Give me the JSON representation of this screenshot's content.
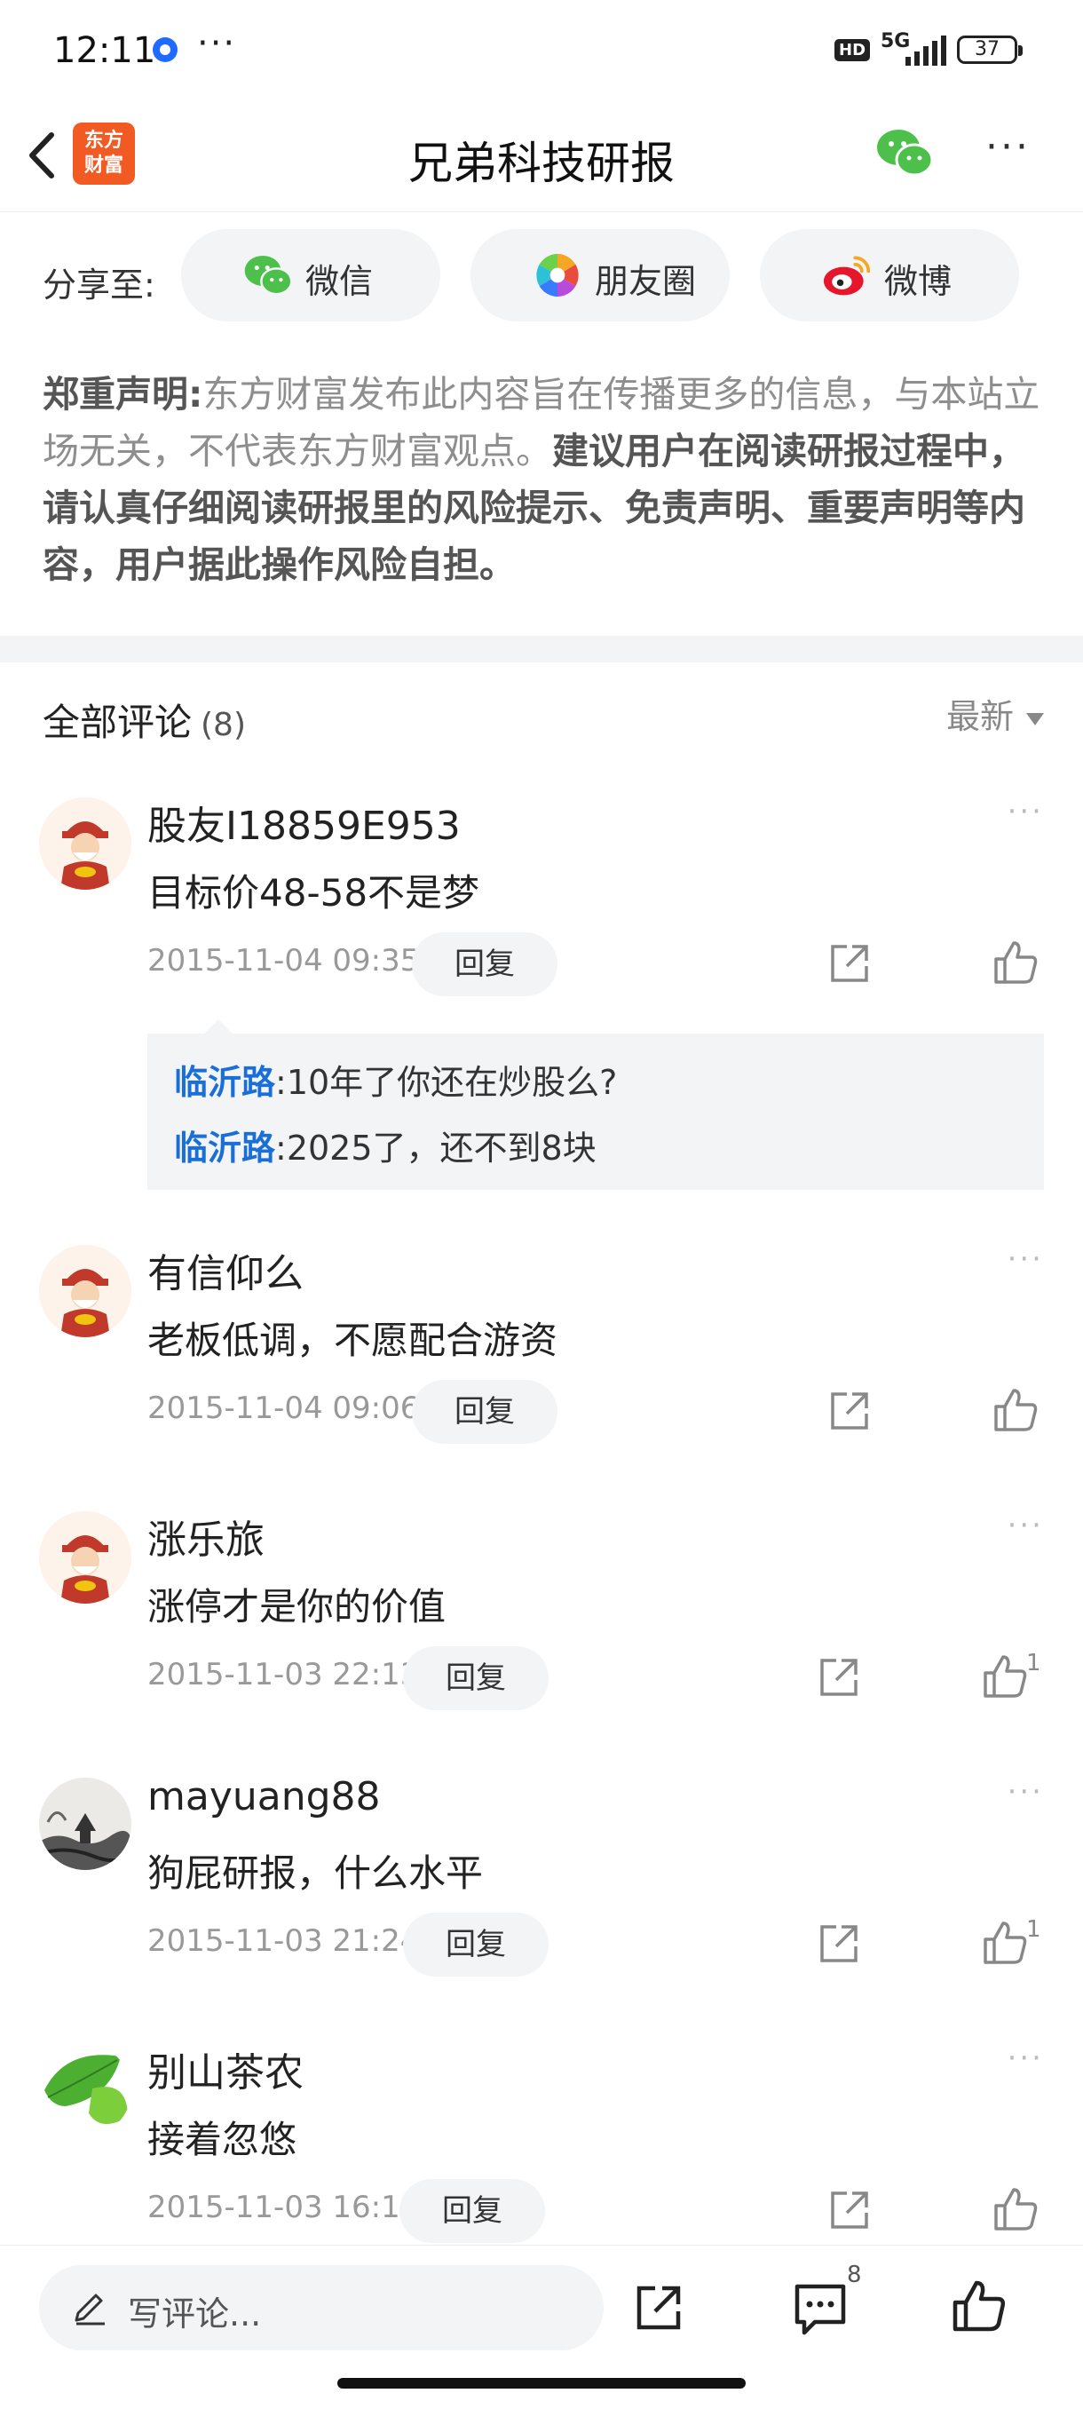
{
  "status_bar": {
    "time": "12:11",
    "more": "···",
    "hd": "HD",
    "network": "5G",
    "battery": "37"
  },
  "nav": {
    "logo_line1": "东方",
    "logo_line2": "财富",
    "title": "兄弟科技研报",
    "more": "···"
  },
  "share": {
    "label": "分享至:",
    "items": [
      {
        "label": "微信",
        "icon": "wechat-icon",
        "color": "#4cc04a"
      },
      {
        "label": "朋友圈",
        "icon": "moments-icon",
        "color": "#f5a623"
      },
      {
        "label": "微博",
        "icon": "weibo-icon",
        "color": "#e6162d"
      }
    ]
  },
  "disclaimer": {
    "title": "郑重声明:",
    "body": "东方财富发布此内容旨在传播更多的信息，与本站立场无关，不代表东方财富观点。",
    "emphasis": "建议用户在阅读研报过程中，请认真仔细阅读研报里的风险提示、免责声明、重要声明等内容，用户据此操作风险自担。"
  },
  "comments_header": {
    "title": "全部评论",
    "count": "(8)",
    "sort": "最新"
  },
  "comments": [
    {
      "user": "股友I18859E953",
      "text": "目标价48-58不是梦",
      "date": "2015-11-04 09:35",
      "reply": "回复",
      "likes": "",
      "avatar": "caishen-avatar"
    },
    {
      "user": "有信仰么",
      "text": "老板低调，不愿配合游资",
      "date": "2015-11-04 09:06",
      "reply": "回复",
      "likes": "",
      "avatar": "caishen-avatar"
    },
    {
      "user": "涨乐旅",
      "text": "涨停才是你的价值",
      "date": "2015-11-03 22:13",
      "reply": "回复",
      "likes": "1",
      "avatar": "caishen-avatar"
    },
    {
      "user": "mayuang88",
      "text": "狗屁研报，什么水平",
      "date": "2015-11-03 21:24",
      "reply": "回复",
      "likes": "1",
      "avatar": "ink-painting-avatar"
    },
    {
      "user": "别山茶农",
      "text": "接着忽悠",
      "date": "2015-11-03 16:13",
      "reply": "回复",
      "likes": "",
      "avatar": "leaf-avatar"
    }
  ],
  "replies": [
    {
      "name": "临沂路",
      "text": ":10年了你还在炒股么?"
    },
    {
      "name": "临沂路",
      "text": ":2025了，还不到8块"
    }
  ],
  "bottom_bar": {
    "placeholder": "写评论...",
    "comment_count": "8"
  }
}
